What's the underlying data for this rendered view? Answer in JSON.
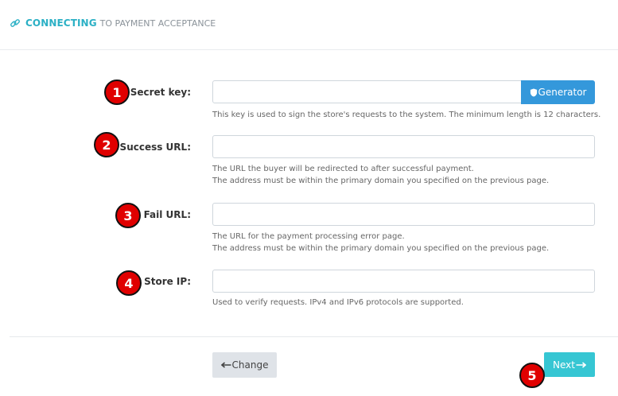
{
  "header": {
    "title_strong": "CONNECTING",
    "title_rest": "TO PAYMENT ACCEPTANCE",
    "icon": "link-icon",
    "accent_color": "#2bb0c5"
  },
  "fields": [
    {
      "badge": "1",
      "label": "Secret key:",
      "value": "",
      "placeholder": "",
      "help": [
        "This key is used to sign the store's requests to the system. The minimum length is 12 characters."
      ]
    },
    {
      "badge": "2",
      "label": "Success URL:",
      "value": "",
      "placeholder": "",
      "help": [
        "The URL the buyer will be redirected to after successful payment.",
        "The address must be within the primary domain you specified on the previous page."
      ]
    },
    {
      "badge": "3",
      "label": "Fail URL:",
      "value": "",
      "placeholder": "",
      "help": [
        "The URL for the payment processing error page.",
        "The address must be within the primary domain you specified on the previous page."
      ]
    },
    {
      "badge": "4",
      "label": "Store IP:",
      "value": "",
      "placeholder": "",
      "help": [
        "Used to verify requests. IPv4 and IPv6 protocols are supported."
      ]
    }
  ],
  "generator": {
    "label": "Generator",
    "icon": "shield-icon",
    "color": "#3498db"
  },
  "footer": {
    "change_label": "Change",
    "change_icon": "arrow-left-icon",
    "next_label": "Next",
    "next_icon": "arrow-right-icon",
    "next_color": "#36c6d3",
    "next_badge": "5"
  },
  "badge_color": "#e00000"
}
